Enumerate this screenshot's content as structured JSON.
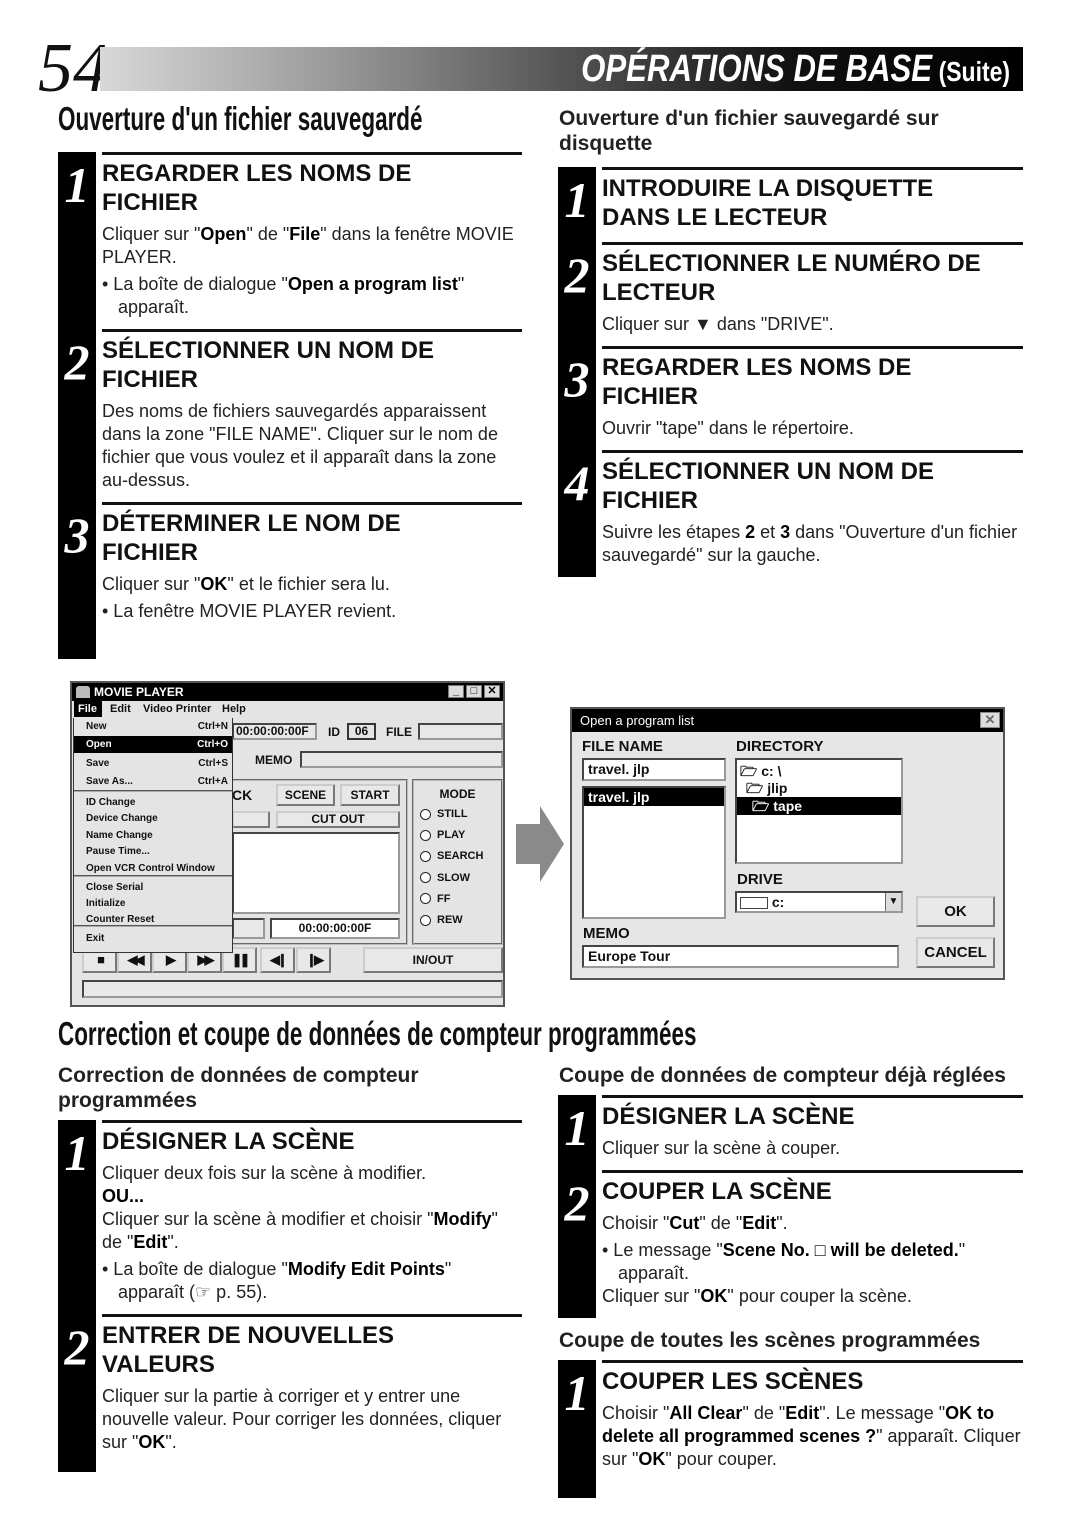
{
  "header": {
    "page_number": "54",
    "title": "OPÉRATIONS DE BASE",
    "title_suffix": "(Suite)"
  },
  "section1": {
    "title": "Ouverture d'un fichier sauvegardé",
    "left_steps": [
      {
        "num": "1",
        "title_lines": [
          "REGARDER LES NOMS DE",
          "FICHIER"
        ],
        "body": [
          {
            "type": "p",
            "runs": [
              {
                "t": "Cliquer sur \""
              },
              {
                "t": "Open",
                "b": true
              },
              {
                "t": "\" de \""
              },
              {
                "t": "File",
                "b": true
              },
              {
                "t": "\" dans la fenêtre MOVIE PLAYER."
              }
            ]
          },
          {
            "type": "bullet",
            "runs": [
              {
                "t": "• La boîte de dialogue \""
              },
              {
                "t": "Open a program list",
                "b": true
              },
              {
                "t": "\" apparaît."
              }
            ]
          }
        ]
      },
      {
        "num": "2",
        "title_lines": [
          "SÉLECTIONNER UN NOM DE",
          "FICHIER"
        ],
        "body": [
          {
            "type": "p",
            "runs": [
              {
                "t": "Des noms de fichiers sauvegardés apparaissent dans la zone \"FILE NAME\". Cliquer sur le nom de fichier que vous voulez et il apparaît dans la zone au-dessus."
              }
            ]
          }
        ]
      },
      {
        "num": "3",
        "title_lines": [
          "DÉTERMINER LE NOM DE",
          "FICHIER"
        ],
        "body": [
          {
            "type": "p",
            "runs": [
              {
                "t": "Cliquer sur \""
              },
              {
                "t": "OK",
                "b": true
              },
              {
                "t": "\" et le fichier sera lu."
              }
            ]
          },
          {
            "type": "bullet",
            "runs": [
              {
                "t": "• La fenêtre MOVIE PLAYER revient."
              }
            ]
          }
        ]
      }
    ],
    "right_subtitle": "Ouverture d'un fichier sauvegardé sur disquette",
    "right_steps": [
      {
        "num": "1",
        "title_lines": [
          "INTRODUIRE LA DISQUETTE",
          "DANS LE LECTEUR"
        ],
        "body": []
      },
      {
        "num": "2",
        "title_lines": [
          "SÉLECTIONNER LE NUMÉRO DE",
          "LECTEUR"
        ],
        "body": [
          {
            "type": "p",
            "runs": [
              {
                "t": "Cliquer sur ▼ dans \"DRIVE\"."
              }
            ]
          }
        ]
      },
      {
        "num": "3",
        "title_lines": [
          "REGARDER LES NOMS DE",
          "FICHIER"
        ],
        "body": [
          {
            "type": "p",
            "runs": [
              {
                "t": "Ouvrir \"tape\" dans le répertoire."
              }
            ]
          }
        ]
      },
      {
        "num": "4",
        "title_lines": [
          "SÉLECTIONNER UN NOM DE",
          "FICHIER"
        ],
        "body": [
          {
            "type": "p",
            "runs": [
              {
                "t": "Suivre les étapes "
              },
              {
                "t": "2",
                "b": true
              },
              {
                "t": " et "
              },
              {
                "t": "3",
                "b": true
              },
              {
                "t": " dans \"Ouverture d'un fichier sauvegardé\" sur la gauche."
              }
            ]
          }
        ]
      }
    ]
  },
  "movie_player": {
    "title": "MOVIE PLAYER",
    "menu": [
      "File",
      "Edit",
      "Video Printer",
      "Help"
    ],
    "file_menu": [
      {
        "label": "New",
        "shortcut": "Ctrl+N"
      },
      {
        "label": "Open",
        "shortcut": "Ctrl+O",
        "selected": true
      },
      {
        "label": "Save",
        "shortcut": "Ctrl+S"
      },
      {
        "label": "Save As...",
        "shortcut": "Ctrl+A"
      },
      {
        "label": "ID Change"
      },
      {
        "label": "Device Change"
      },
      {
        "label": "Name Change"
      },
      {
        "label": "Pause Time..."
      },
      {
        "label": "Open VCR Control Window"
      },
      {
        "label": "Close Serial"
      },
      {
        "label": "Initialize"
      },
      {
        "label": "Counter Reset"
      },
      {
        "label": "Exit"
      }
    ],
    "counter": "00:00:00:00F",
    "id_label": "ID",
    "id_value": "06",
    "file_label": "FILE",
    "memo_label": "MEMO",
    "partial_label": "CK",
    "scene_button": "SCENE",
    "start_button": "START",
    "cutout_button": "CUT OUT",
    "counter2": "00:00:00:00F",
    "mode_label": "MODE",
    "modes": [
      "STILL",
      "PLAY",
      "SEARCH",
      "SLOW",
      "FF",
      "REW"
    ],
    "inout_button": "IN/OUT"
  },
  "dialog": {
    "title": "Open a program list",
    "file_name_label": "FILE NAME",
    "file_name_value": "travel. jlp",
    "file_list": [
      "travel. jlp"
    ],
    "directory_label": "DIRECTORY",
    "directories": [
      "c: \\",
      "jlip",
      "tape"
    ],
    "drive_label": "DRIVE",
    "drive_value": "c:",
    "memo_label": "MEMO",
    "memo_value": "Europe Tour",
    "ok_button": "OK",
    "cancel_button": "CANCEL"
  },
  "section2": {
    "title": "Correction et coupe de données de compteur programmées",
    "left_subtitle": "Correction de données de compteur programmées",
    "left_steps": [
      {
        "num": "1",
        "title_lines": [
          "DÉSIGNER LA SCÈNE"
        ],
        "body": [
          {
            "type": "p",
            "runs": [
              {
                "t": "Cliquer deux fois sur la scène à modifier."
              }
            ]
          },
          {
            "type": "p",
            "runs": [
              {
                "t": "OU...",
                "b": true
              }
            ]
          },
          {
            "type": "p",
            "runs": [
              {
                "t": "Cliquer sur la scène à modifier et choisir \""
              },
              {
                "t": "Modify",
                "b": true
              },
              {
                "t": "\" de \""
              },
              {
                "t": "Edit",
                "b": true
              },
              {
                "t": "\"."
              }
            ]
          },
          {
            "type": "bullet",
            "runs": [
              {
                "t": "• La boîte de dialogue \""
              },
              {
                "t": "Modify Edit Points",
                "b": true
              },
              {
                "t": "\" apparaît (☞ p. 55)."
              }
            ]
          }
        ]
      },
      {
        "num": "2",
        "title_lines": [
          "ENTRER DE NOUVELLES",
          "VALEURS"
        ],
        "body": [
          {
            "type": "p",
            "runs": [
              {
                "t": "Cliquer sur la partie à corriger et y entrer une nouvelle valeur. Pour corriger les données, cliquer sur \""
              },
              {
                "t": "OK",
                "b": true
              },
              {
                "t": "\"."
              }
            ]
          }
        ]
      }
    ],
    "right_subtitle": "Coupe de données de compteur déjà réglées",
    "right_steps": [
      {
        "num": "1",
        "title_lines": [
          "DÉSIGNER LA SCÈNE"
        ],
        "body": [
          {
            "type": "p",
            "runs": [
              {
                "t": "Cliquer sur la scène à couper."
              }
            ]
          }
        ]
      },
      {
        "num": "2",
        "title_lines": [
          "COUPER LA SCÈNE"
        ],
        "body": [
          {
            "type": "p",
            "runs": [
              {
                "t": "Choisir \""
              },
              {
                "t": "Cut",
                "b": true
              },
              {
                "t": "\" de \""
              },
              {
                "t": "Edit",
                "b": true
              },
              {
                "t": "\"."
              }
            ]
          },
          {
            "type": "bullet",
            "runs": [
              {
                "t": "• Le message \""
              },
              {
                "t": "Scene No. □ will be deleted.",
                "b": true
              },
              {
                "t": "\" apparaît."
              }
            ]
          },
          {
            "type": "p",
            "runs": [
              {
                "t": "Cliquer sur \""
              },
              {
                "t": "OK",
                "b": true
              },
              {
                "t": "\" pour couper la scène."
              }
            ]
          }
        ]
      }
    ],
    "right_subtitle2": "Coupe de toutes les scènes programmées",
    "right_steps2": [
      {
        "num": "1",
        "title_lines": [
          "COUPER LES SCÈNES"
        ],
        "body": [
          {
            "type": "p",
            "runs": [
              {
                "t": "Choisir \""
              },
              {
                "t": "All Clear",
                "b": true
              },
              {
                "t": "\" de \""
              },
              {
                "t": "Edit",
                "b": true
              },
              {
                "t": "\". Le message \""
              },
              {
                "t": "OK to delete all programmed scenes ?",
                "b": true
              },
              {
                "t": "\" apparaît. Cliquer sur \""
              },
              {
                "t": "OK",
                "b": true
              },
              {
                "t": "\" pour couper."
              }
            ]
          }
        ]
      }
    ]
  }
}
